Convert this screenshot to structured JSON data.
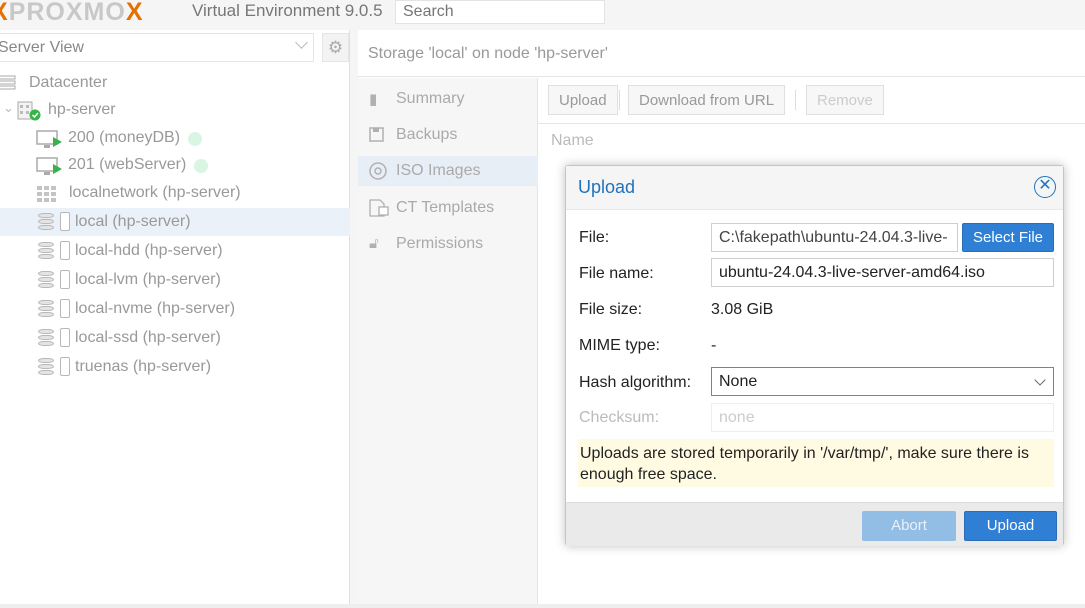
{
  "header": {
    "logo_text": "PROXMOX",
    "version": "Virtual Environment 9.0.5",
    "search_placeholder": "Search"
  },
  "sidebar": {
    "view_select": "Server View",
    "datacenter": "Datacenter",
    "node": "hp-server",
    "items": [
      {
        "label": "200 (moneyDB)",
        "type": "vm",
        "status": "running"
      },
      {
        "label": "201 (webServer)",
        "type": "vm",
        "status": "running"
      },
      {
        "label": "localnetwork (hp-server)",
        "type": "sdn"
      },
      {
        "label": "local (hp-server)",
        "type": "storage",
        "selected": true
      },
      {
        "label": "local-hdd (hp-server)",
        "type": "storage"
      },
      {
        "label": "local-lvm (hp-server)",
        "type": "storage"
      },
      {
        "label": "local-nvme (hp-server)",
        "type": "storage"
      },
      {
        "label": "local-ssd (hp-server)",
        "type": "storage"
      },
      {
        "label": "truenas (hp-server)",
        "type": "storage"
      }
    ]
  },
  "content": {
    "title": "Storage 'local' on node 'hp-server'",
    "nav": [
      {
        "label": "Summary",
        "icon": "book-icon"
      },
      {
        "label": "Backups",
        "icon": "floppy-icon"
      },
      {
        "label": "ISO Images",
        "icon": "disc-icon",
        "active": true
      },
      {
        "label": "CT Templates",
        "icon": "template-icon"
      },
      {
        "label": "Permissions",
        "icon": "unlock-icon"
      }
    ],
    "toolbar": {
      "upload": "Upload",
      "download_url": "Download from URL",
      "remove": "Remove"
    },
    "column_name": "Name"
  },
  "dialog": {
    "title": "Upload",
    "file_label": "File:",
    "file_value": "C:\\fakepath\\ubuntu-24.04.3-live-",
    "select_file": "Select File",
    "filename_label": "File name:",
    "filename_value": "ubuntu-24.04.3-live-server-amd64.iso",
    "filesize_label": "File size:",
    "filesize_value": "3.08 GiB",
    "mime_label": "MIME type:",
    "mime_value": "-",
    "hash_label": "Hash algorithm:",
    "hash_value": "None",
    "checksum_label": "Checksum:",
    "checksum_placeholder": "none",
    "notice": "Uploads are stored temporarily in '/var/tmp/', make sure there is enough free space.",
    "abort": "Abort",
    "upload": "Upload"
  },
  "colors": {
    "accent": "#2f7fd4",
    "title_blue": "#2073ba",
    "logo_orange": "#e57000",
    "notice_bg": "#fffbe3",
    "running_dot": "#d9f5e3"
  }
}
